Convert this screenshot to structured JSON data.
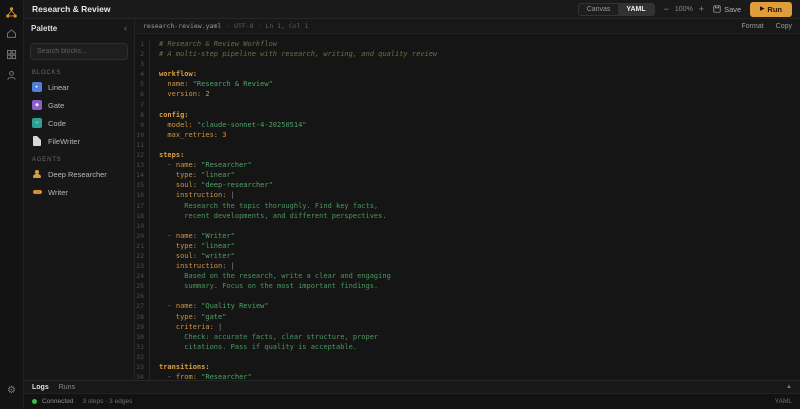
{
  "app": {
    "title": "Research & Review"
  },
  "colors": {
    "accent": "#e29d3b",
    "key": "#cf9440",
    "string": "#4ea366",
    "comment": "#6c6f45",
    "connected_dot": "#3fb950"
  },
  "rail": {
    "icons": [
      "logo-icon",
      "home-icon",
      "blocks-icon",
      "agents-icon",
      "settings-gear-icon"
    ],
    "gear_glyph": "⚙"
  },
  "topbar": {
    "title": "Research & Review",
    "view_toggle": {
      "options": [
        "Canvas",
        "YAML"
      ],
      "selected": "YAML"
    },
    "zoom": {
      "out": "−",
      "level": "100%",
      "in": "+"
    },
    "save_label": "Save",
    "run_label": "Run",
    "run_icon": "▶"
  },
  "palette": {
    "title": "Palette",
    "collapse_icon": "‹",
    "search_placeholder": "Search blocks...",
    "sections": [
      {
        "label": "BLOCKS",
        "items": [
          {
            "label": "Linear",
            "icon": "linear-icon",
            "style": "square",
            "color": "#4f7fd9",
            "glyph": "▸"
          },
          {
            "label": "Gate",
            "icon": "gate-icon",
            "style": "square",
            "color": "#8a5fc9",
            "glyph": "◆"
          },
          {
            "label": "Code",
            "icon": "code-icon",
            "style": "square",
            "color": "#2fa08f",
            "glyph": "‹›"
          },
          {
            "label": "FileWriter",
            "icon": "filewriter-icon",
            "style": "file",
            "color": "#d5d8dc",
            "glyph": ""
          }
        ]
      },
      {
        "label": "AGENTS",
        "items": [
          {
            "label": "Deep Researcher",
            "icon": "deep-researcher-icon",
            "style": "person",
            "color": "#c9a24a",
            "glyph": ""
          },
          {
            "label": "Writer",
            "icon": "writer-icon",
            "style": "pen",
            "color": "#d98e2b",
            "glyph": ""
          }
        ]
      }
    ]
  },
  "editor": {
    "tab": {
      "filename": "research-review.yaml",
      "meta": "· UTF-8 · Ln 1, Col 1"
    },
    "actions": [
      "Format",
      "Copy"
    ],
    "lines": [
      {
        "n": 1,
        "s": [
          [
            "# Research & Review Workflow",
            "cm"
          ]
        ]
      },
      {
        "n": 2,
        "s": [
          [
            "# A multi-step pipeline with research, writing, and quality review",
            "cm"
          ]
        ]
      },
      {
        "n": 3,
        "s": []
      },
      {
        "n": 4,
        "s": [
          [
            "workflow:",
            "keyb"
          ]
        ]
      },
      {
        "n": 5,
        "s": [
          [
            "  name: ",
            "key"
          ],
          [
            "\"Research & Review\"",
            "str"
          ]
        ]
      },
      {
        "n": 6,
        "s": [
          [
            "  version: ",
            "key"
          ],
          [
            "2",
            "num"
          ]
        ]
      },
      {
        "n": 7,
        "s": []
      },
      {
        "n": 8,
        "s": [
          [
            "config:",
            "keyb"
          ]
        ]
      },
      {
        "n": 9,
        "s": [
          [
            "  model: ",
            "key"
          ],
          [
            "\"claude-sonnet-4-20250514\"",
            "str"
          ]
        ]
      },
      {
        "n": 10,
        "s": [
          [
            "  max_retries: ",
            "key"
          ],
          [
            "3",
            "num"
          ]
        ]
      },
      {
        "n": 11,
        "s": []
      },
      {
        "n": 12,
        "s": [
          [
            "steps:",
            "keyb"
          ]
        ]
      },
      {
        "n": 13,
        "s": [
          [
            "  - ",
            "pun"
          ],
          [
            "name: ",
            "key"
          ],
          [
            "\"Researcher\"",
            "str"
          ]
        ]
      },
      {
        "n": 14,
        "s": [
          [
            "    type: ",
            "key"
          ],
          [
            "\"linear\"",
            "str"
          ]
        ]
      },
      {
        "n": 15,
        "s": [
          [
            "    soul: ",
            "key"
          ],
          [
            "\"deep-researcher\"",
            "str"
          ]
        ]
      },
      {
        "n": 16,
        "s": [
          [
            "    instruction: ",
            "key"
          ],
          [
            "|",
            "pun"
          ]
        ]
      },
      {
        "n": 17,
        "s": [
          [
            "      Research the topic thoroughly. Find key facts,",
            "txt"
          ]
        ]
      },
      {
        "n": 18,
        "s": [
          [
            "      recent developments, and different perspectives.",
            "txt"
          ]
        ]
      },
      {
        "n": 19,
        "s": []
      },
      {
        "n": 20,
        "s": [
          [
            "  - ",
            "pun"
          ],
          [
            "name: ",
            "key"
          ],
          [
            "\"Writer\"",
            "str"
          ]
        ]
      },
      {
        "n": 21,
        "s": [
          [
            "    type: ",
            "key"
          ],
          [
            "\"linear\"",
            "str"
          ]
        ]
      },
      {
        "n": 22,
        "s": [
          [
            "    soul: ",
            "key"
          ],
          [
            "\"writer\"",
            "str"
          ]
        ]
      },
      {
        "n": 23,
        "s": [
          [
            "    instruction: ",
            "key"
          ],
          [
            "|",
            "pun"
          ]
        ]
      },
      {
        "n": 24,
        "s": [
          [
            "      Based on the research, write a clear and engaging",
            "txt"
          ]
        ]
      },
      {
        "n": 25,
        "s": [
          [
            "      summary. Focus on the most important findings.",
            "txt"
          ]
        ]
      },
      {
        "n": 26,
        "s": []
      },
      {
        "n": 27,
        "s": [
          [
            "  - ",
            "pun"
          ],
          [
            "name: ",
            "key"
          ],
          [
            "\"Quality Review\"",
            "str"
          ]
        ]
      },
      {
        "n": 28,
        "s": [
          [
            "    type: ",
            "key"
          ],
          [
            "\"gate\"",
            "str"
          ]
        ]
      },
      {
        "n": 29,
        "s": [
          [
            "    criteria: ",
            "key"
          ],
          [
            "|",
            "pun"
          ]
        ]
      },
      {
        "n": 30,
        "s": [
          [
            "      Check: accurate facts, clear structure, proper",
            "txt"
          ]
        ]
      },
      {
        "n": 31,
        "s": [
          [
            "      citations. Pass if quality is acceptable.",
            "txt"
          ]
        ]
      },
      {
        "n": 32,
        "s": []
      },
      {
        "n": 33,
        "s": [
          [
            "transitions:",
            "keyb"
          ]
        ]
      },
      {
        "n": 34,
        "s": [
          [
            "  - ",
            "pun"
          ],
          [
            "from: ",
            "key"
          ],
          [
            "\"Researcher\"",
            "str"
          ]
        ]
      }
    ]
  },
  "bottom": {
    "tabs": [
      "Logs",
      "Runs"
    ],
    "selected_tab": "Logs",
    "collapse_icon": "▲",
    "status": {
      "connection": "Connected",
      "summary": "3 steps · 3 edges",
      "mode": "YAML"
    }
  }
}
